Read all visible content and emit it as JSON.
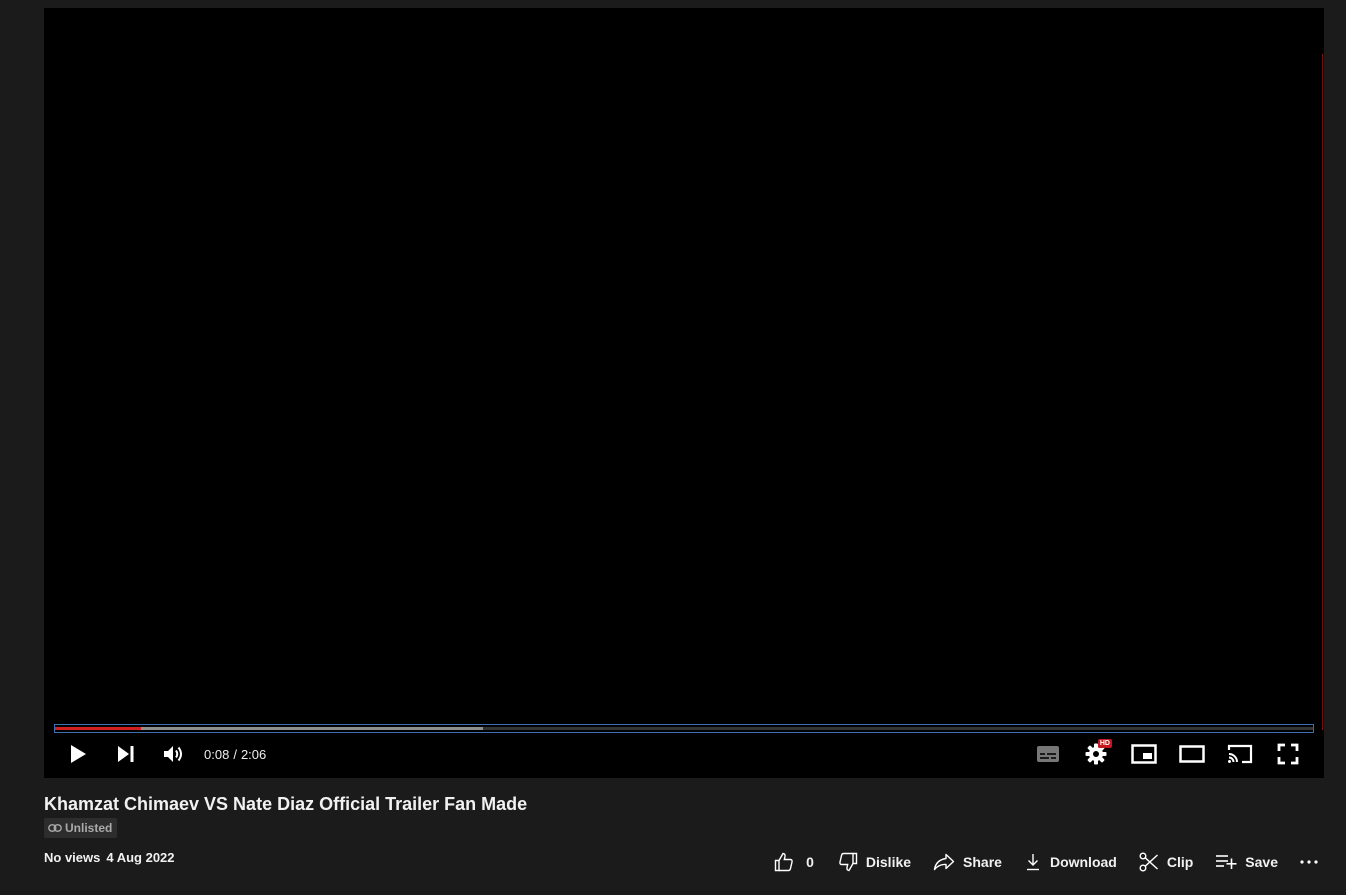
{
  "player": {
    "current_time": "0:08",
    "separator": "/",
    "duration": "2:06",
    "progress_played_fraction": 0.068,
    "progress_buffered_fraction": 0.34,
    "hd_badge": "HD"
  },
  "video": {
    "title": "Khamzat Chimaev VS Nate Diaz Official Trailer Fan Made",
    "visibility": "Unlisted",
    "views": "No views",
    "date": "4 Aug 2022"
  },
  "actions": {
    "like_count": "0",
    "dislike_label": "Dislike",
    "share_label": "Share",
    "download_label": "Download",
    "clip_label": "Clip",
    "save_label": "Save"
  },
  "colors": {
    "background": "#1b1b1b",
    "player_bg": "#000000",
    "progress_played": "#d21f1f",
    "hd_badge": "#c4171e"
  }
}
